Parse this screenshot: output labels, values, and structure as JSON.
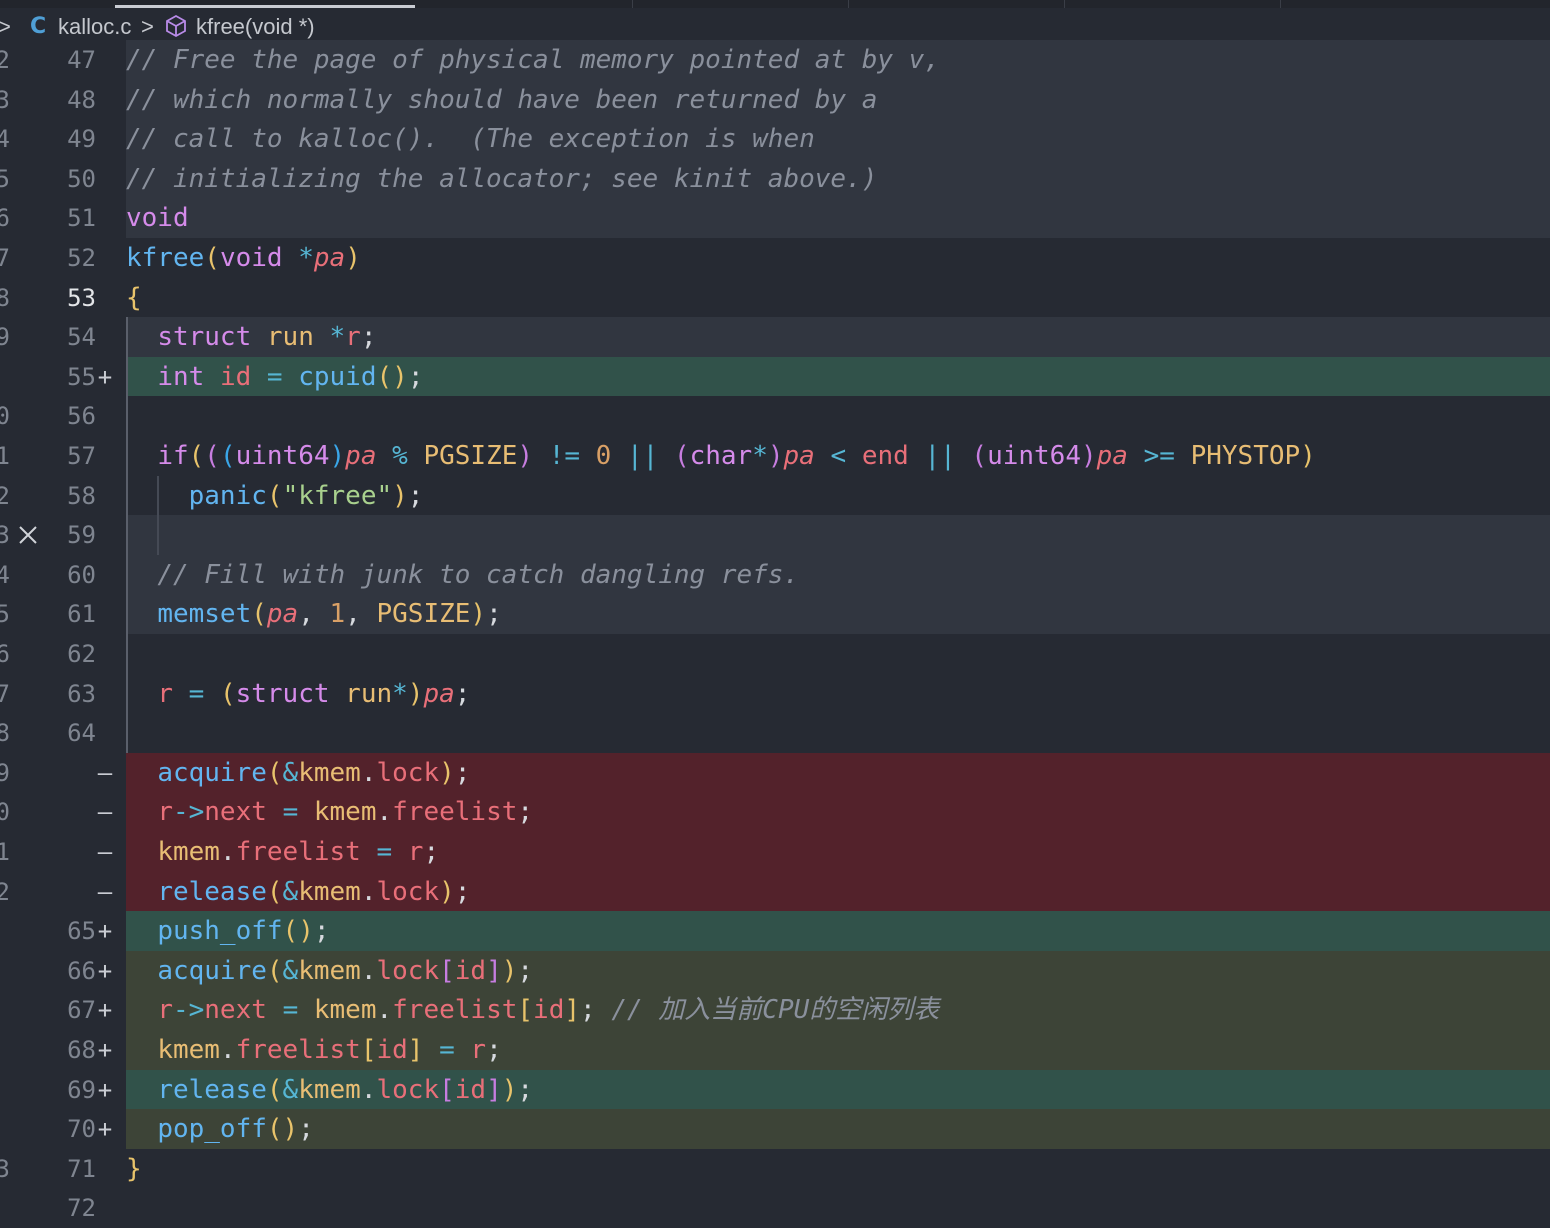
{
  "breadcrumb": {
    "file_icon": "C",
    "file": "kalloc.c",
    "separator": ">",
    "symbol": "kfree(void *)"
  },
  "colors": {
    "removed_bg": "#53222b",
    "added_bg": "#31524a",
    "added_alt_bg": "#3d4437",
    "context_bg": "#313640",
    "editor_bg": "#262a33"
  },
  "lines": [
    {
      "outer": "2",
      "num": "47",
      "mark": "",
      "code": "// Free the page of physical memory pointed at by v,"
    },
    {
      "outer": "3",
      "num": "48",
      "mark": "",
      "code": "// which normally should have been returned by a"
    },
    {
      "outer": "4",
      "num": "49",
      "mark": "",
      "code": "// call to kalloc().  (The exception is when"
    },
    {
      "outer": "5",
      "num": "50",
      "mark": "",
      "code": "// initializing the allocator; see kinit above.)"
    },
    {
      "outer": "6",
      "num": "51",
      "mark": "",
      "code": "void"
    },
    {
      "outer": "7",
      "num": "52",
      "mark": "",
      "code": "kfree(void *pa)"
    },
    {
      "outer": "8",
      "num": "53",
      "mark": "",
      "code": "{"
    },
    {
      "outer": "9",
      "num": "54",
      "mark": "",
      "code": "  struct run *r;"
    },
    {
      "outer": "",
      "num": "55",
      "mark": "+",
      "code": "  int id = cpuid();"
    },
    {
      "outer": "0",
      "num": "56",
      "mark": "",
      "code": ""
    },
    {
      "outer": "1",
      "num": "57",
      "mark": "",
      "code": "  if(((uint64)pa % PGSIZE) != 0 || (char*)pa < end || (uint64)pa >= PHYSTOP)"
    },
    {
      "outer": "2",
      "num": "58",
      "mark": "",
      "code": "    panic(\"kfree\");"
    },
    {
      "outer": "3",
      "num": "59",
      "mark": "",
      "code": ""
    },
    {
      "outer": "4",
      "num": "60",
      "mark": "",
      "code": "  // Fill with junk to catch dangling refs."
    },
    {
      "outer": "5",
      "num": "61",
      "mark": "",
      "code": "  memset(pa, 1, PGSIZE);"
    },
    {
      "outer": "6",
      "num": "62",
      "mark": "",
      "code": ""
    },
    {
      "outer": "7",
      "num": "63",
      "mark": "",
      "code": "  r = (struct run*)pa;"
    },
    {
      "outer": "8",
      "num": "64",
      "mark": "",
      "code": ""
    },
    {
      "outer": "9",
      "num": "",
      "mark": "—",
      "code": "  acquire(&kmem.lock);"
    },
    {
      "outer": "0",
      "num": "",
      "mark": "—",
      "code": "  r->next = kmem.freelist;"
    },
    {
      "outer": "1",
      "num": "",
      "mark": "—",
      "code": "  kmem.freelist = r;"
    },
    {
      "outer": "2",
      "num": "",
      "mark": "—",
      "code": "  release(&kmem.lock);"
    },
    {
      "outer": "",
      "num": "65",
      "mark": "+",
      "code": "  push_off();"
    },
    {
      "outer": "",
      "num": "66",
      "mark": "+",
      "code": "  acquire(&kmem.lock[id]);"
    },
    {
      "outer": "",
      "num": "67",
      "mark": "+",
      "code": "  r->next = kmem.freelist[id]; // 加入当前CPU的空闲列表"
    },
    {
      "outer": "",
      "num": "68",
      "mark": "+",
      "code": "  kmem.freelist[id] = r;"
    },
    {
      "outer": "",
      "num": "69",
      "mark": "+",
      "code": "  release(&kmem.lock[id]);"
    },
    {
      "outer": "",
      "num": "70",
      "mark": "+",
      "code": "  pop_off();"
    },
    {
      "outer": "3",
      "num": "71",
      "mark": "",
      "code": "}"
    },
    {
      "outer": "",
      "num": "72",
      "mark": "",
      "code": ""
    }
  ]
}
